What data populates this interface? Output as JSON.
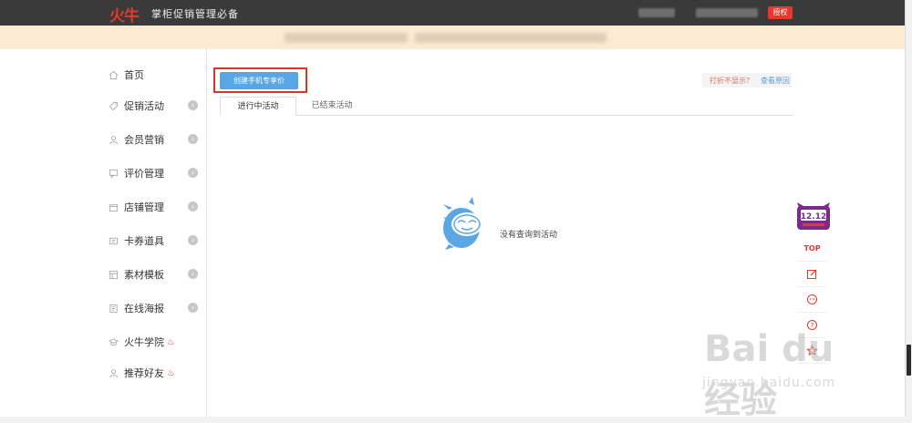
{
  "header": {
    "logo": "火牛",
    "title": "掌柜促销管理必备",
    "auth_label": "授权"
  },
  "sidebar": {
    "items": [
      {
        "label": "首页",
        "icon": "home-icon"
      },
      {
        "label": "促销活动",
        "icon": "tag-icon"
      },
      {
        "label": "会员营销",
        "icon": "user-icon"
      },
      {
        "label": "评价管理",
        "icon": "comment-icon"
      },
      {
        "label": "店铺管理",
        "icon": "shop-icon"
      },
      {
        "label": "卡券道具",
        "icon": "coupon-icon"
      },
      {
        "label": "素材模板",
        "icon": "template-icon"
      },
      {
        "label": "在线海报",
        "icon": "poster-icon"
      },
      {
        "label": "火牛学院",
        "icon": "academy-icon"
      },
      {
        "label": "推荐好友",
        "icon": "friend-icon"
      }
    ]
  },
  "main": {
    "create_button": "创建手机专享价",
    "help": {
      "question": "打折不显示？",
      "link": "查看原因"
    },
    "tabs": [
      {
        "label": "进行中活动"
      },
      {
        "label": "已结束活动"
      }
    ],
    "empty_text": "没有查询到活动"
  },
  "tools": {
    "top_label": "TOP",
    "promo_label": "12.12"
  },
  "watermark": {
    "main": "Bai du 经验",
    "sub": "jingyan.baidu.com"
  },
  "colors": {
    "brand_red": "#e8372b",
    "primary_blue": "#58a6e6",
    "header_bg": "#3a3a3a",
    "notice_bg": "#fcebd2"
  }
}
